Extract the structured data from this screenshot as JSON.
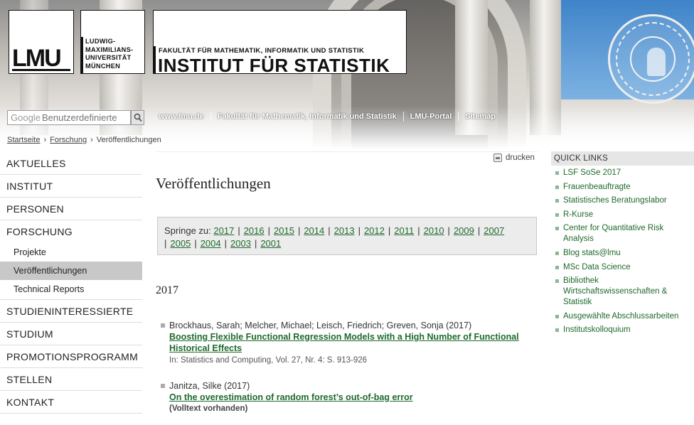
{
  "header": {
    "lmu_mark": "LMU",
    "university_name": "LUDWIG-\nMAXIMILIANS-\nUNIVERSITÄT\nMÜNCHEN",
    "faculty": "FAKULTÄT FÜR MATHEMATIK, INFORMATIK UND STATISTIK",
    "institute": "INSTITUT FÜR STATISTIK",
    "search": {
      "brand": "Google",
      "placeholder": "Benutzerdefinierte"
    },
    "topnav": [
      {
        "label": "www.lmu.de"
      },
      {
        "label": "Fakultät für Mathematik, Informatik und Statistik"
      },
      {
        "label": "LMU-Portal"
      },
      {
        "label": "Sitemap"
      }
    ]
  },
  "breadcrumb": {
    "items": [
      {
        "label": "Startseite"
      },
      {
        "label": "Forschung"
      }
    ],
    "current": "Veröffentlichungen",
    "separator": "›"
  },
  "sidebar": {
    "items": [
      {
        "label": "AKTUELLES"
      },
      {
        "label": "INSTITUT"
      },
      {
        "label": "PERSONEN"
      },
      {
        "label": "FORSCHUNG"
      }
    ],
    "subitems": [
      {
        "label": "Projekte"
      },
      {
        "label": "Veröffentlichungen"
      },
      {
        "label": "Technical Reports"
      }
    ],
    "items_after": [
      {
        "label": "STUDIENINTERESSIERTE"
      },
      {
        "label": "STUDIUM"
      },
      {
        "label": "PROMOTIONSPROGRAMM"
      },
      {
        "label": "STELLEN"
      },
      {
        "label": "KONTAKT"
      }
    ]
  },
  "main": {
    "print_label": "drucken",
    "title": "Veröffentlichungen",
    "jump_label": "Springe zu:",
    "years": [
      "2017",
      "2016",
      "2015",
      "2014",
      "2013",
      "2012",
      "2011",
      "2010",
      "2009",
      "2007",
      "2005",
      "2004",
      "2003",
      "2001"
    ],
    "section_year": "2017",
    "publications": [
      {
        "authors": "Brockhaus, Sarah; Melcher, Michael; Leisch, Friedrich; Greven, Sonja (2017)",
        "title": "Boosting Flexible Functional Regression Models with a High Number of Functional Historical Effects",
        "source": "In: Statistics and Computing, Vol. 27, Nr. 4: S. 913-926"
      },
      {
        "authors": "Janitza, Silke (2017)",
        "title": "On the overestimation of random forest’s out-of-bag error",
        "note": "(Volltext vorhanden)"
      }
    ]
  },
  "quicklinks": {
    "heading": "QUICK LINKS",
    "items": [
      {
        "label": "LSF SoSe 2017"
      },
      {
        "label": "Frauenbeauftragte"
      },
      {
        "label": "Statistisches Beratungslabor"
      },
      {
        "label": "R-Kurse"
      },
      {
        "label": "Center for Quantitative Risk Analysis"
      },
      {
        "label": "Blog stats@lmu"
      },
      {
        "label": "MSc Data Science"
      },
      {
        "label": "Bibliothek Wirtschaftswissenschaften & Statistik"
      },
      {
        "label": "Ausgewählte Abschlussarbeiten"
      },
      {
        "label": "Institutskolloquium"
      }
    ]
  },
  "colors": {
    "link_green": "#1f6a2c",
    "nav_active_bg": "#c8c8c8",
    "quicklink_bullet": "#8fb596"
  }
}
